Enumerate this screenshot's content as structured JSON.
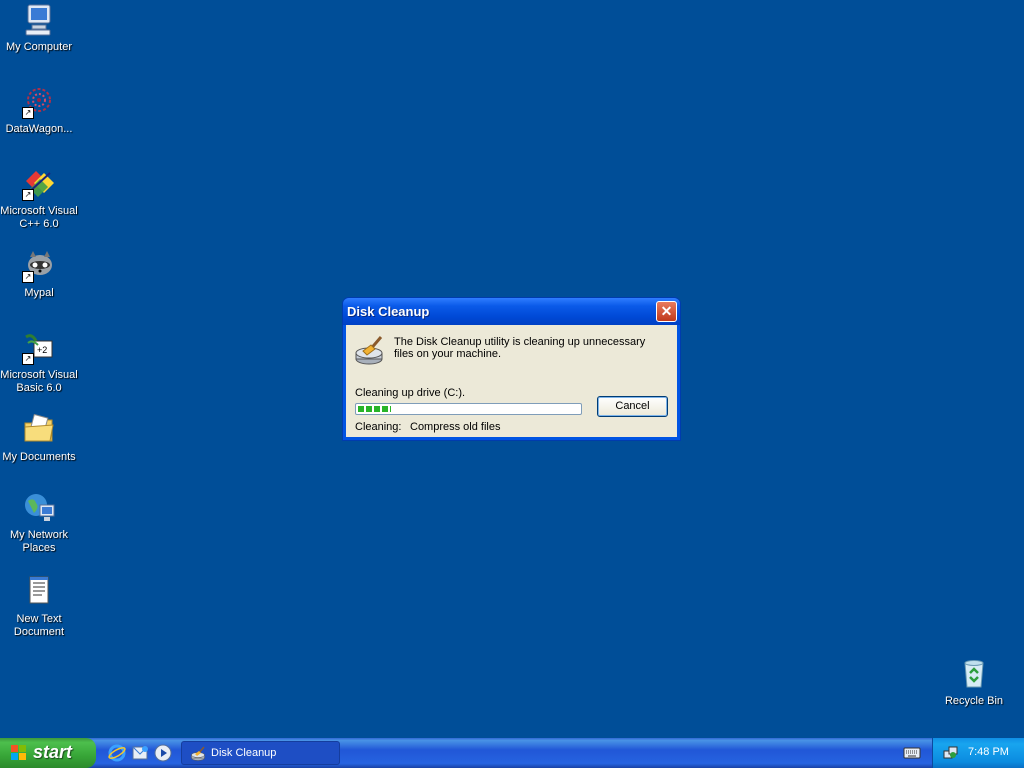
{
  "desktop": {
    "icons": [
      {
        "label": "My Computer",
        "icon": "computer-icon"
      },
      {
        "label": "DataWagon...",
        "icon": "datawagon-icon"
      },
      {
        "label": "Microsoft Visual\nC++ 6.0",
        "icon": "visual-cpp-icon"
      },
      {
        "label": "Mypal",
        "icon": "mypal-icon"
      },
      {
        "label": "Microsoft Visual\nBasic 6.0",
        "icon": "visual-basic-icon"
      },
      {
        "label": "My Documents",
        "icon": "folder-documents-icon"
      },
      {
        "label": "My Network\nPlaces",
        "icon": "network-places-icon"
      },
      {
        "label": "New Text\nDocument",
        "icon": "text-document-icon"
      },
      {
        "label": "Recycle Bin",
        "icon": "recycle-bin-icon"
      }
    ],
    "background_color": "#004e98"
  },
  "dialog": {
    "title": "Disk Cleanup",
    "close_label": "✕",
    "message": "The Disk Cleanup utility is cleaning up unnecessary files on your machine.",
    "drive_label": "Cleaning up drive  (C:).",
    "progress_fraction": 0.15,
    "cancel_label": "Cancel",
    "cleaning_label": "Cleaning:",
    "cleaning_item": "Compress old files"
  },
  "taskbar": {
    "start_label": "start",
    "quick_launch": [
      "internet-explorer-icon",
      "outlook-express-icon",
      "media-player-icon"
    ],
    "task_button_label": "Disk Cleanup",
    "clock": "7:48 PM"
  }
}
